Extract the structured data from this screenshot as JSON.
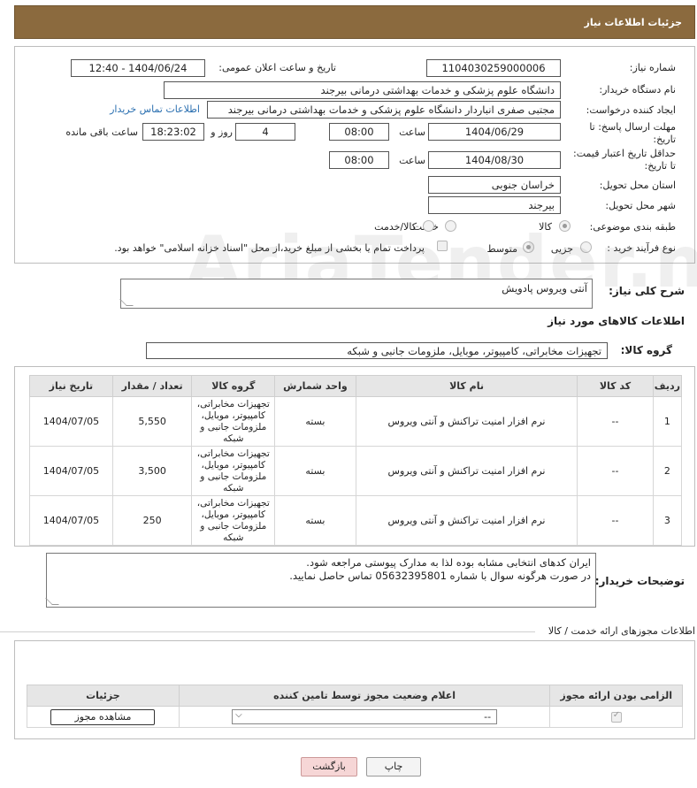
{
  "header": {
    "title": "جزئیات اطلاعات نیاز"
  },
  "form": {
    "need_number_label": "شماره نیاز:",
    "need_number": "1104030259000006",
    "announce_label": "تاریخ و ساعت اعلان عمومی:",
    "announce_value": "1404/06/24 - 12:40",
    "buyer_org_label": "نام دستگاه خریدار:",
    "buyer_org": "دانشگاه علوم پزشکی و خدمات بهداشتی درمانی بیرجند",
    "creator_label": "ایجاد کننده درخواست:",
    "creator": "مجتبی صفری انباردار دانشگاه علوم پزشکی و خدمات بهداشتی درمانی بیرجند",
    "contact_link": "اطلاعات تماس خریدار",
    "deadline_label": "مهلت ارسال پاسخ: تا تاریخ:",
    "deadline_date": "1404/06/29",
    "time_label": "ساعت",
    "deadline_time": "08:00",
    "days_value": "4",
    "days_label": "روز و",
    "remaining_time": "18:23:02",
    "remaining_label": "ساعت باقی مانده",
    "price_validity_label": "حداقل تاریخ اعتبار قیمت: تا تاریخ:",
    "price_date": "1404/08/30",
    "price_time": "08:00",
    "province_label": "استان محل تحویل:",
    "province": "خراسان جنوبی",
    "city_label": "شهر محل تحویل:",
    "city": "بیرجند",
    "category_label": "طبقه بندی موضوعی:",
    "category_options": [
      "کالا",
      "خدمت",
      "کالا/خدمت"
    ],
    "process_label": "نوع فرآیند خرید :",
    "process_options": [
      "جزیی",
      "متوسط"
    ],
    "payment_note": "پرداخت تمام یا بخشی از مبلغ خرید،از محل \"اسناد خزانه اسلامی\" خواهد بود."
  },
  "summary": {
    "label": "شرح کلی نیاز:",
    "value": "آنتی ویروس پادویش"
  },
  "goods": {
    "section_title": "اطلاعات کالاهای مورد نیاز",
    "group_label": "گروه کالا:",
    "group_value": "تجهیزات مخابراتی، کامپیوتر، موبایل، ملزومات جانبی و شبکه",
    "columns": [
      "ردیف",
      "کد کالا",
      "نام کالا",
      "واحد شمارش",
      "گروه کالا",
      "تعداد / مقدار",
      "تاریخ نیاز"
    ],
    "rows": [
      {
        "row": "1",
        "code": "--",
        "name": "نرم افزار امنیت تراکنش و آنتی ویروس",
        "unit": "بسته",
        "group": "تجهیزات مخابراتی، کامپیوتر، موبایل، ملزومات جانبی و شبکه",
        "qty": "5,550",
        "date": "1404/07/05"
      },
      {
        "row": "2",
        "code": "--",
        "name": "نرم افزار امنیت تراکنش و آنتی ویروس",
        "unit": "بسته",
        "group": "تجهیزات مخابراتی، کامپیوتر، موبایل، ملزومات جانبی و شبکه",
        "qty": "3,500",
        "date": "1404/07/05"
      },
      {
        "row": "3",
        "code": "--",
        "name": "نرم افزار امنیت تراکنش و آنتی ویروس",
        "unit": "بسته",
        "group": "تجهیزات مخابراتی، کامپیوتر، موبایل، ملزومات جانبی و شبکه",
        "qty": "250",
        "date": "1404/07/05"
      }
    ]
  },
  "buyer_notes": {
    "label": "توضیحات خریدار:",
    "line1": "ایران کدهای انتخابی مشابه بوده لذا به مدارک پیوستی مراجعه شود.",
    "line2": "در صورت هرگونه سوال با شماره 05632395801 تماس حاصل نمایید."
  },
  "permits": {
    "section_title": "اطلاعات مجوزهای ارائه خدمت / کالا",
    "columns": [
      "الزامی بودن ارائه مجوز",
      "اعلام وضعیت مجوز توسط تامین کننده",
      "جزئیات"
    ],
    "select_value": "--",
    "view_button": "مشاهده مجوز"
  },
  "footer": {
    "print_button": "چاپ",
    "back_button": "بازگشت"
  },
  "watermark": "AriaTender.neT"
}
